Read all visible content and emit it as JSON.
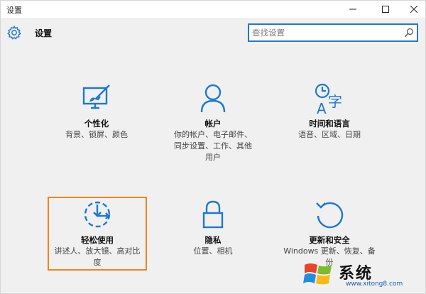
{
  "window": {
    "title": "设置"
  },
  "header": {
    "title": "设置",
    "search_placeholder": "查找设置"
  },
  "tiles": [
    {
      "name": "个性化",
      "desc": "背景、锁屏、颜色"
    },
    {
      "name": "帐户",
      "desc": "你的帐户、电子邮件、同步设置、工作、其他用户"
    },
    {
      "name": "时间和语言",
      "desc": "语音、区域、日期"
    },
    {
      "name": "轻松使用",
      "desc": "讲述人、放大镜、高对比度"
    },
    {
      "name": "隐私",
      "desc": "位置、相机"
    },
    {
      "name": "更新和安全",
      "desc": "Windows 更新、恢复、备份"
    }
  ],
  "watermark": {
    "brand": "系统",
    "url": "www.xitong8.com"
  },
  "colors": {
    "accent": "#1e78d2",
    "highlight": "#f5821f"
  }
}
